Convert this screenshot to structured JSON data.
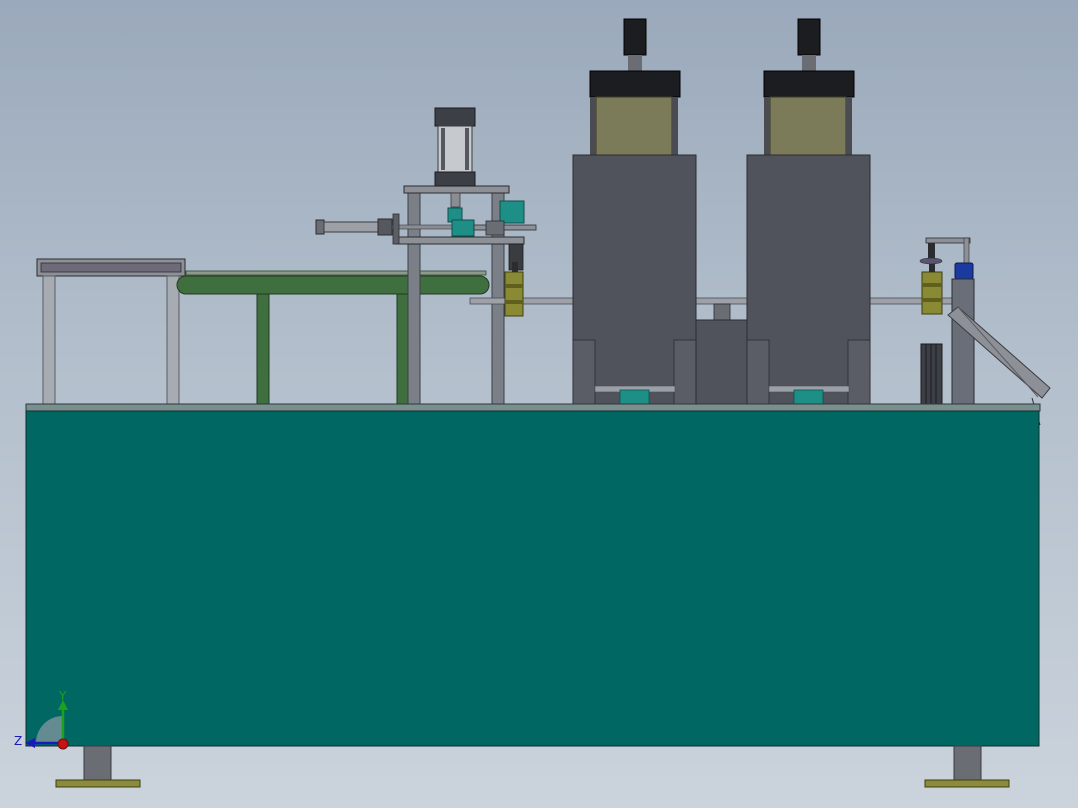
{
  "viewport": {
    "background_top": "#9aa9bb",
    "background_bottom": "#cbd3dc"
  },
  "model": {
    "name": "packaging-line-front-view",
    "colors": {
      "base_cabinet": "#006763",
      "frame_gray": "#7a7f88",
      "steel_light": "#a9adb3",
      "hopper_body": "#50535c",
      "hopper_window": "#7c7b59",
      "cap_black": "#1c1d21",
      "conveyor_green": "#3f6e3f",
      "accent_teal": "#1d8f86",
      "brass": "#8a8a34",
      "motor_blue": "#1b3aa0",
      "foot_olive": "#8c8a3c"
    }
  },
  "triad": {
    "y_label": "Y",
    "z_label": "Z",
    "y_color": "#1aa31a",
    "z_color": "#1a1ab8",
    "origin_color": "#cc1111"
  }
}
